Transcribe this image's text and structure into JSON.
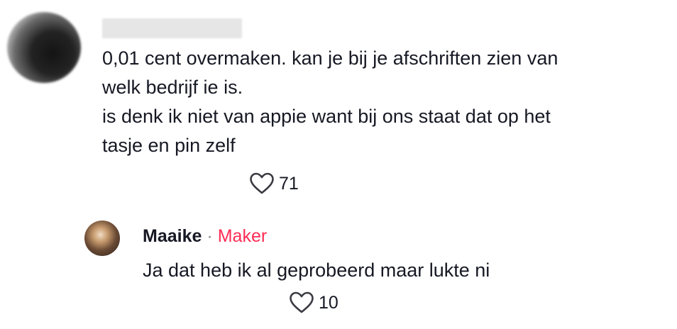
{
  "comment": {
    "lines": [
      "0,01 cent overmaken. kan je bij je afschriften zien van",
      "welk bedrijf ie is.",
      "is denk ik niet van appie want bij ons staat dat op het",
      "tasje en pin zelf"
    ],
    "like_icon": "heart-outline-icon",
    "likes": "71"
  },
  "reply": {
    "author": "Maaike",
    "separator": "·",
    "badge": "Maker",
    "badge_color": "#fe2c55",
    "text": "Ja dat heb ik al geprobeerd maar lukte ni",
    "like_icon": "heart-outline-icon",
    "likes": "10"
  }
}
